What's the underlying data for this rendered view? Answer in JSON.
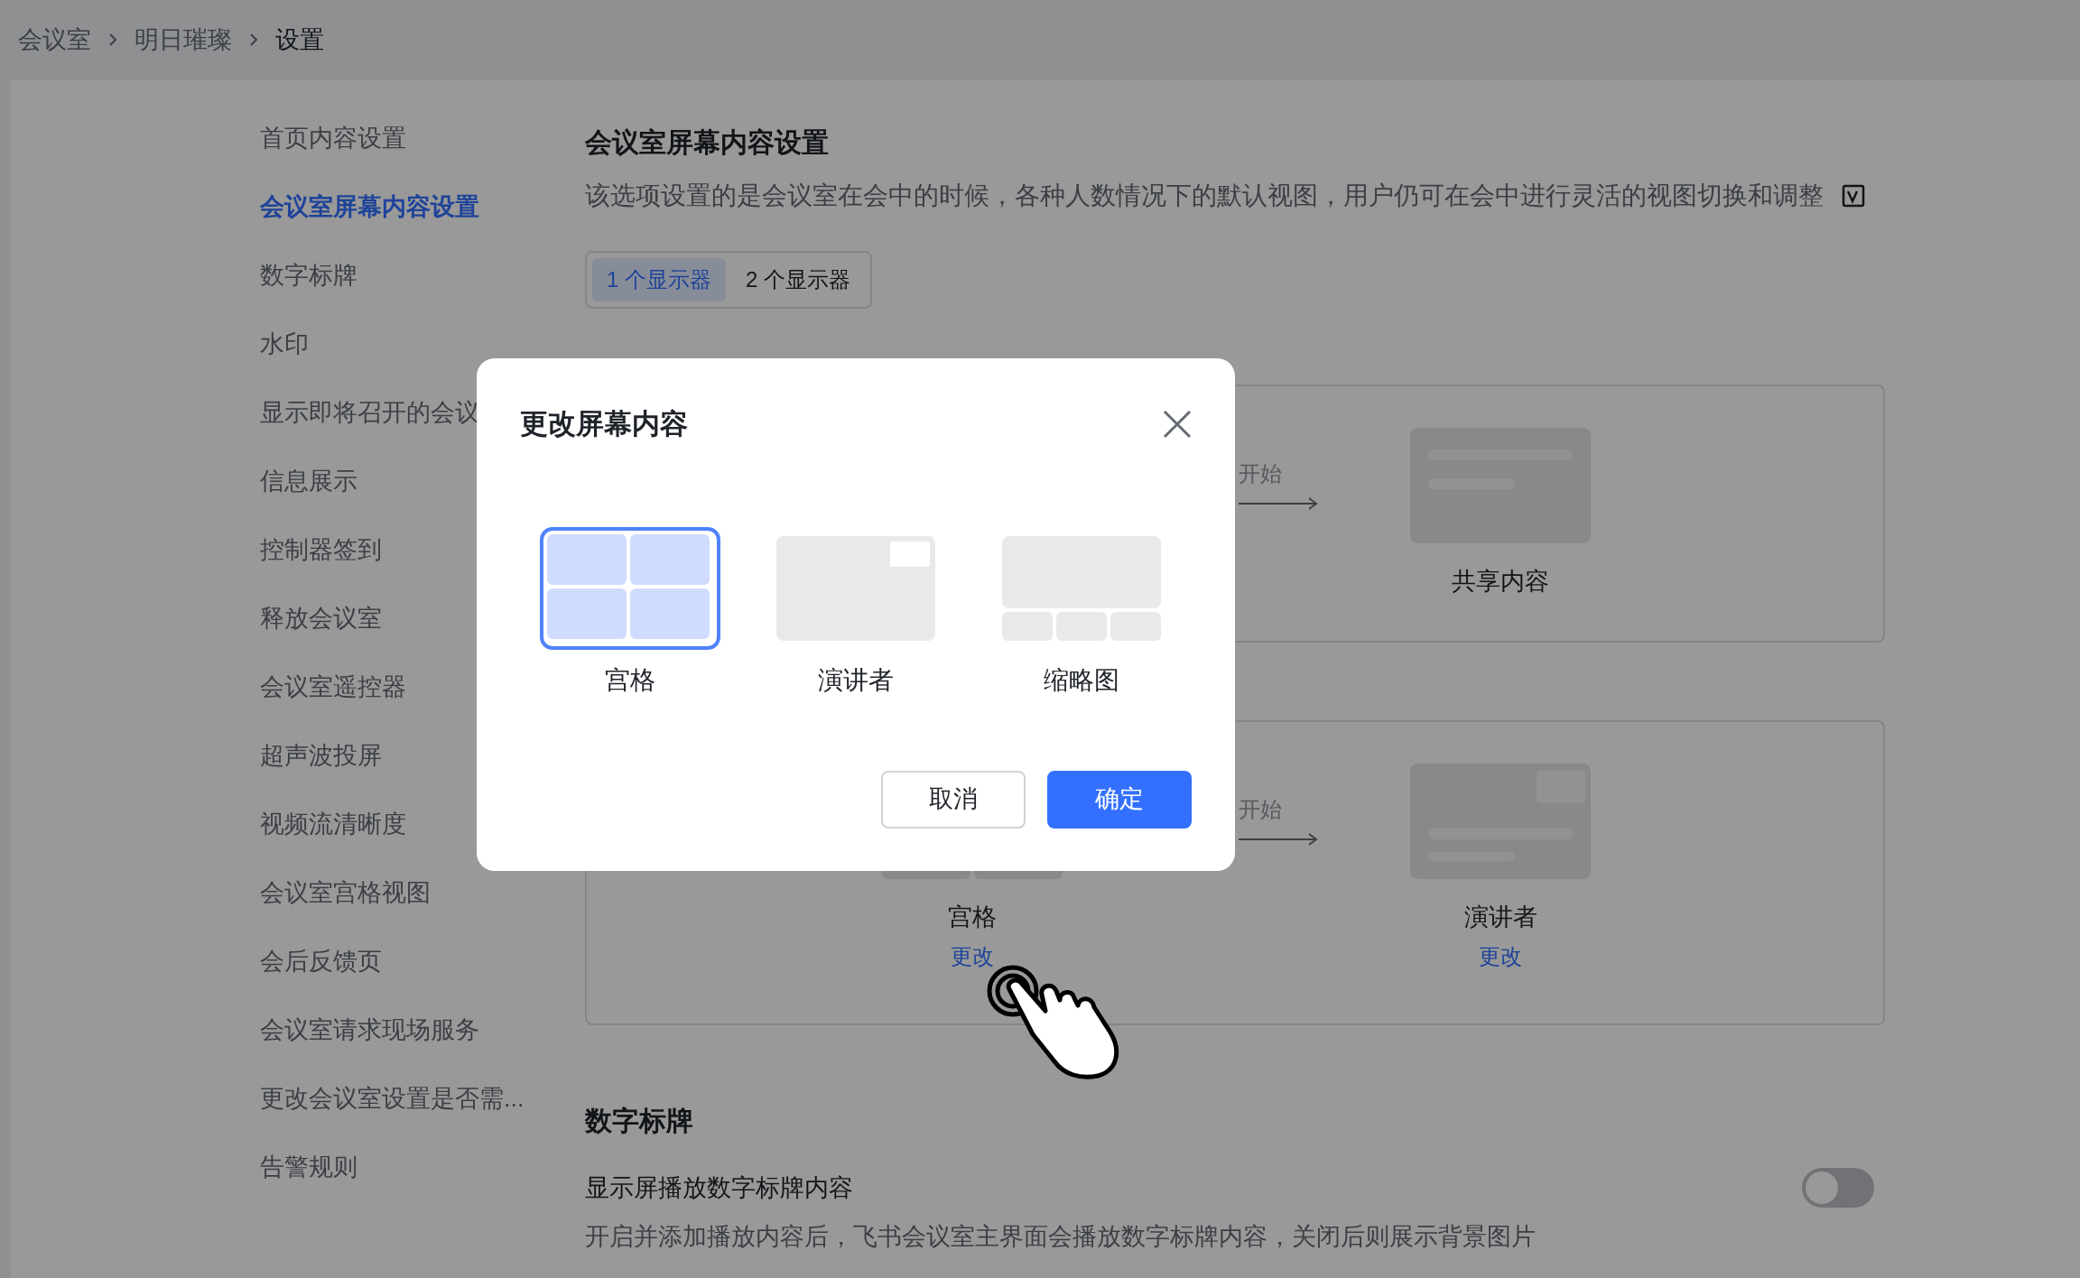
{
  "breadcrumb": [
    {
      "label": "会议室"
    },
    {
      "label": "明日璀璨"
    },
    {
      "label": "设置"
    }
  ],
  "sidebar": {
    "items": [
      {
        "label": "首页内容设置",
        "selected": false
      },
      {
        "label": "会议室屏幕内容设置",
        "selected": true
      },
      {
        "label": "数字标牌",
        "selected": false
      },
      {
        "label": "水印",
        "selected": false
      },
      {
        "label": "显示即将召开的会议",
        "selected": false
      },
      {
        "label": "信息展示",
        "selected": false
      },
      {
        "label": "控制器签到",
        "selected": false
      },
      {
        "label": "释放会议室",
        "selected": false
      },
      {
        "label": "会议室遥控器",
        "selected": false
      },
      {
        "label": "超声波投屏",
        "selected": false
      },
      {
        "label": "视频流清晰度",
        "selected": false
      },
      {
        "label": "会议室宫格视图",
        "selected": false
      },
      {
        "label": "会后反馈页",
        "selected": false
      },
      {
        "label": "会议室请求现场服务",
        "selected": false
      },
      {
        "label": "更改会议室设置是否需...",
        "selected": false
      },
      {
        "label": "告警规则",
        "selected": false
      }
    ]
  },
  "screen_content": {
    "title": "会议室屏幕内容设置",
    "description": "该选项设置的是会议室在会中的时候，各种人数情况下的默认视图，用户仍可在会中进行灵活的视图切换和调整",
    "tabs": [
      {
        "label": "1 个显示器",
        "selected": true
      },
      {
        "label": "2 个显示器",
        "selected": false
      }
    ],
    "cards": [
      {
        "start_label": "开始",
        "to": {
          "kind": "share",
          "label": "共享内容"
        }
      },
      {
        "start_label": "开始",
        "from": {
          "kind": "grid",
          "label": "宫格",
          "link": "更改"
        },
        "to": {
          "kind": "speaker",
          "label": "演讲者",
          "link": "更改"
        }
      }
    ]
  },
  "digital_signage": {
    "title": "数字标牌",
    "setting_label": "显示屏播放数字标牌内容",
    "setting_description": "开启并添加播放内容后，飞书会议室主界面会播放数字标牌内容，关闭后则展示背景图片",
    "toggle": {
      "on": false
    }
  },
  "dialog": {
    "title": "更改屏幕内容",
    "options": [
      {
        "kind": "grid",
        "label": "宫格",
        "selected": true
      },
      {
        "kind": "speaker",
        "label": "演讲者",
        "selected": false
      },
      {
        "kind": "thumbnail",
        "label": "缩略图",
        "selected": false
      }
    ],
    "buttons": [
      {
        "kind": "secondary",
        "label": "取消"
      },
      {
        "kind": "primary",
        "label": "确定"
      }
    ]
  }
}
